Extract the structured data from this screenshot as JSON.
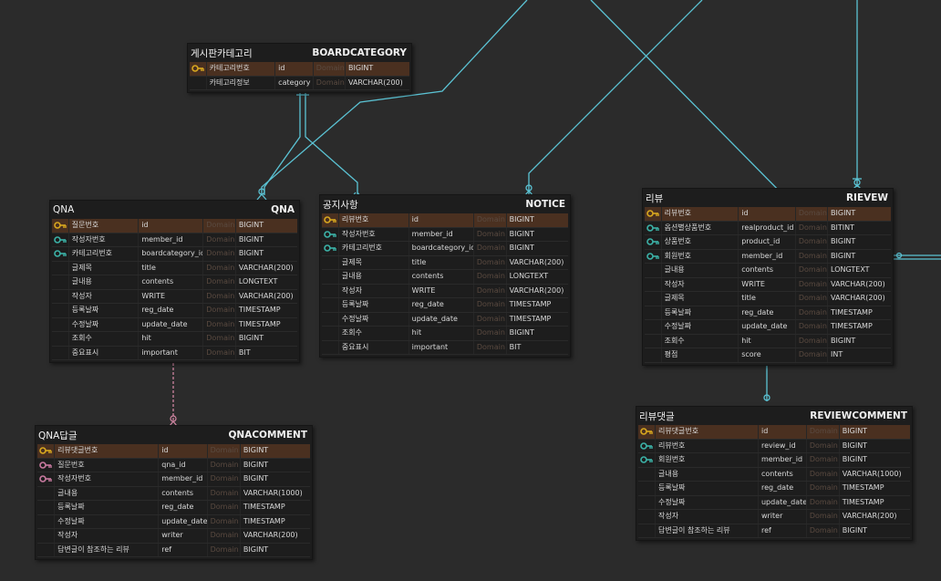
{
  "colors": {
    "background": "#2b2b2b",
    "line": "#5bc3d4",
    "pk_row": "#4a3020",
    "pk_key": "#d9a81f",
    "fk_key": "#3cb3a8",
    "pfk_key": "#c97aa0"
  },
  "entities": {
    "boardcategory": {
      "logical": "게시판카테고리",
      "physical": "BOARDCATEGORY",
      "rows": [
        {
          "key": "pk-icon",
          "logical": "카테고리번호",
          "physical": "id",
          "domain": "Domain",
          "type": "BIGINT"
        },
        {
          "key": "",
          "logical": "카테고리정보",
          "physical": "category",
          "domain": "Domain",
          "type": "VARCHAR(200)"
        }
      ]
    },
    "qna": {
      "logical": "QNA",
      "physical": "QNA",
      "rows": [
        {
          "key": "pk-icon",
          "logical": "질문번호",
          "physical": "id",
          "domain": "Domain",
          "type": "BIGINT"
        },
        {
          "key": "fk-icon",
          "logical": "작성자번호",
          "physical": "member_id",
          "domain": "Domain",
          "type": "BIGINT"
        },
        {
          "key": "fk-icon",
          "logical": "카테고리번호",
          "physical": "boardcategory_id",
          "domain": "Domain",
          "type": "BIGINT"
        },
        {
          "key": "",
          "logical": "글제목",
          "physical": "title",
          "domain": "Domain",
          "type": "VARCHAR(200)"
        },
        {
          "key": "",
          "logical": "글내용",
          "physical": "contents",
          "domain": "Domain",
          "type": "LONGTEXT"
        },
        {
          "key": "",
          "logical": "작성자",
          "physical": "WRITE",
          "domain": "Domain",
          "type": "VARCHAR(200)"
        },
        {
          "key": "",
          "logical": "등록날짜",
          "physical": "reg_date",
          "domain": "Domain",
          "type": "TIMESTAMP"
        },
        {
          "key": "",
          "logical": "수정날짜",
          "physical": "update_date",
          "domain": "Domain",
          "type": "TIMESTAMP"
        },
        {
          "key": "",
          "logical": "조회수",
          "physical": "hit",
          "domain": "Domain",
          "type": "BIGINT"
        },
        {
          "key": "",
          "logical": "중요표시",
          "physical": "important",
          "domain": "Domain",
          "type": "BIT"
        }
      ]
    },
    "notice": {
      "logical": "공지사항",
      "physical": "NOTICE",
      "rows": [
        {
          "key": "pk-icon",
          "logical": "리뷰번호",
          "physical": "id",
          "domain": "Domain",
          "type": "BIGINT"
        },
        {
          "key": "fk-icon",
          "logical": "작성자번호",
          "physical": "member_id",
          "domain": "Domain",
          "type": "BIGINT"
        },
        {
          "key": "fk-icon",
          "logical": "카테고리번호",
          "physical": "boardcategory_id",
          "domain": "Domain",
          "type": "BIGINT"
        },
        {
          "key": "",
          "logical": "글제목",
          "physical": "title",
          "domain": "Domain",
          "type": "VARCHAR(200)"
        },
        {
          "key": "",
          "logical": "글내용",
          "physical": "contents",
          "domain": "Domain",
          "type": "LONGTEXT"
        },
        {
          "key": "",
          "logical": "작성자",
          "physical": "WRITE",
          "domain": "Domain",
          "type": "VARCHAR(200)"
        },
        {
          "key": "",
          "logical": "등록날짜",
          "physical": "reg_date",
          "domain": "Domain",
          "type": "TIMESTAMP"
        },
        {
          "key": "",
          "logical": "수정날짜",
          "physical": "update_date",
          "domain": "Domain",
          "type": "TIMESTAMP"
        },
        {
          "key": "",
          "logical": "조회수",
          "physical": "hit",
          "domain": "Domain",
          "type": "BIGINT"
        },
        {
          "key": "",
          "logical": "중요표시",
          "physical": "important",
          "domain": "Domain",
          "type": "BIT"
        }
      ]
    },
    "review": {
      "logical": "리뷰",
      "physical": "RIEVEW",
      "rows": [
        {
          "key": "pk-icon",
          "logical": "리뷰번호",
          "physical": "id",
          "domain": "Domain",
          "type": "BIGINT"
        },
        {
          "key": "fk-icon",
          "logical": "옵션별상품번호",
          "physical": "realproduct_id",
          "domain": "Domain",
          "type": "BITINT"
        },
        {
          "key": "fk-icon",
          "logical": "상품번호",
          "physical": "product_id",
          "domain": "Domain",
          "type": "BIGINT"
        },
        {
          "key": "fk-icon",
          "logical": "회원번호",
          "physical": "member_id",
          "domain": "Domain",
          "type": "BIGINT"
        },
        {
          "key": "",
          "logical": "글내용",
          "physical": "contents",
          "domain": "Domain",
          "type": "LONGTEXT"
        },
        {
          "key": "",
          "logical": "작성자",
          "physical": "WRITE",
          "domain": "Domain",
          "type": "VARCHAR(200)"
        },
        {
          "key": "",
          "logical": "글제목",
          "physical": "title",
          "domain": "Domain",
          "type": "VARCHAR(200)"
        },
        {
          "key": "",
          "logical": "등록날짜",
          "physical": "reg_date",
          "domain": "Domain",
          "type": "TIMESTAMP"
        },
        {
          "key": "",
          "logical": "수정날짜",
          "physical": "update_date",
          "domain": "Domain",
          "type": "TIMESTAMP"
        },
        {
          "key": "",
          "logical": "조회수",
          "physical": "hit",
          "domain": "Domain",
          "type": "BIGINT"
        },
        {
          "key": "",
          "logical": "평점",
          "physical": "score",
          "domain": "Domain",
          "type": "INT"
        }
      ]
    },
    "qnacomment": {
      "logical": "QNA답글",
      "physical": "QNACOMMENT",
      "rows": [
        {
          "key": "pk-icon",
          "logical": "리뷰댓글번호",
          "physical": "id",
          "domain": "Domain",
          "type": "BIGINT"
        },
        {
          "key": "pfk-icon",
          "logical": "질문번호",
          "physical": "qna_id",
          "domain": "Domain",
          "type": "BIGINT"
        },
        {
          "key": "pfk-icon",
          "logical": "작성자번호",
          "physical": "member_id",
          "domain": "Domain",
          "type": "BIGINT"
        },
        {
          "key": "",
          "logical": "글내용",
          "physical": "contents",
          "domain": "Domain",
          "type": "VARCHAR(1000)"
        },
        {
          "key": "",
          "logical": "등록날짜",
          "physical": "reg_date",
          "domain": "Domain",
          "type": "TIMESTAMP"
        },
        {
          "key": "",
          "logical": "수정날짜",
          "physical": "update_date",
          "domain": "Domain",
          "type": "TIMESTAMP"
        },
        {
          "key": "",
          "logical": "작성자",
          "physical": "writer",
          "domain": "Domain",
          "type": "VARCHAR(200)"
        },
        {
          "key": "",
          "logical": "답변글이 참조하는 리뷰",
          "physical": "ref",
          "domain": "Domain",
          "type": "BIGINT"
        }
      ]
    },
    "reviewcomment": {
      "logical": "리뷰댓글",
      "physical": "REVIEWCOMMENT",
      "rows": [
        {
          "key": "pk-icon",
          "logical": "리뷰댓글번호",
          "physical": "id",
          "domain": "Domain",
          "type": "BIGINT"
        },
        {
          "key": "fk-icon",
          "logical": "리뷰번호",
          "physical": "review_id",
          "domain": "Domain",
          "type": "BIGINT"
        },
        {
          "key": "fk-icon",
          "logical": "회원번호",
          "physical": "member_id",
          "domain": "Domain",
          "type": "BIGINT"
        },
        {
          "key": "",
          "logical": "글내용",
          "physical": "contents",
          "domain": "Domain",
          "type": "VARCHAR(1000)"
        },
        {
          "key": "",
          "logical": "등록날짜",
          "physical": "reg_date",
          "domain": "Domain",
          "type": "TIMESTAMP"
        },
        {
          "key": "",
          "logical": "수정날짜",
          "physical": "update_date",
          "domain": "Domain",
          "type": "TIMESTAMP"
        },
        {
          "key": "",
          "logical": "작성자",
          "physical": "writer",
          "domain": "Domain",
          "type": "VARCHAR(200)"
        },
        {
          "key": "",
          "logical": "답변글이 참조하는 리뷰",
          "physical": "ref",
          "domain": "Domain",
          "type": "BIGINT"
        }
      ]
    }
  }
}
